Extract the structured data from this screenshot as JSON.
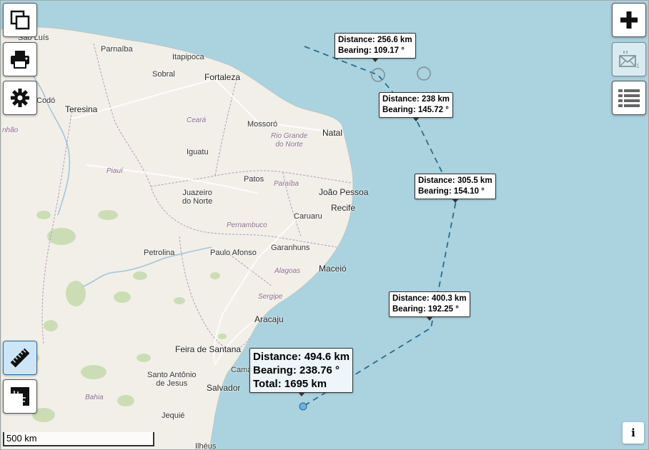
{
  "places": {
    "sao_luis": "São Luís",
    "parnaiba": "Parnaíba",
    "itapipoca": "Itapipoca",
    "sobral": "Sobral",
    "fortaleza": "Fortaleza",
    "codo": "Codó",
    "teresina": "Teresina",
    "ceara": "Ceará",
    "mossoro": "Mossoró",
    "maranhao": "nhão",
    "rio_grande_1": "Rio Grande",
    "rio_grande_2": "do Norte",
    "natal": "Natal",
    "iguatu": "Iguatu",
    "piaui": "Piauí",
    "patos": "Patos",
    "paraiba": "Paraíba",
    "joao_pessoa": "João Pessoa",
    "juazeiro_1": "Juazeiro",
    "juazeiro_2": "do Norte",
    "caruaru": "Caruaru",
    "recife": "Recife",
    "pernambuco": "Pernambuco",
    "petrolina": "Petrolina",
    "paulo_afonso": "Paulo Afonso",
    "garanhuns": "Garanhuns",
    "alagoas": "Alagoas",
    "maceio": "Maceió",
    "sergipe": "Sergipe",
    "aracaju": "Aracaju",
    "feira": "Feira de Santana",
    "santo_antonio_1": "Santo Antônio",
    "santo_antonio_2": "de Jesus",
    "camacari": "Cama",
    "salvador": "Salvador",
    "bahia": "Bahia",
    "jequie": "Jequié",
    "ilheus": "Ilhéus"
  },
  "measure": {
    "segments": [
      {
        "distance": "Distance: 256.6 km",
        "bearing": "Bearing: 109.17 °"
      },
      {
        "distance": "Distance: 238 km",
        "bearing": "Bearing: 145.72 °"
      },
      {
        "distance": "Distance: 305.5 km",
        "bearing": "Bearing: 154.10 °"
      },
      {
        "distance": "Distance: 400.3 km",
        "bearing": "Bearing: 192.25 °"
      }
    ],
    "final": {
      "distance": "Distance: 494.6 km",
      "bearing": "Bearing: 238.76 °",
      "total": "Total: 1695 km"
    }
  },
  "controls": {
    "left": [
      "copy-layers-icon",
      "printer-icon",
      "gear-icon"
    ],
    "right": [
      "plus-icon",
      "envelope-icon",
      "list-icon"
    ],
    "tools": [
      "ruler-icon",
      "corner-ruler-icon"
    ]
  },
  "scale": {
    "label": "500 km"
  },
  "info": {
    "label": "i"
  },
  "colors": {
    "sea": "#aad3df",
    "land": "#f2efe9",
    "route": "#2c6a8c",
    "active": "#cde6f7"
  }
}
